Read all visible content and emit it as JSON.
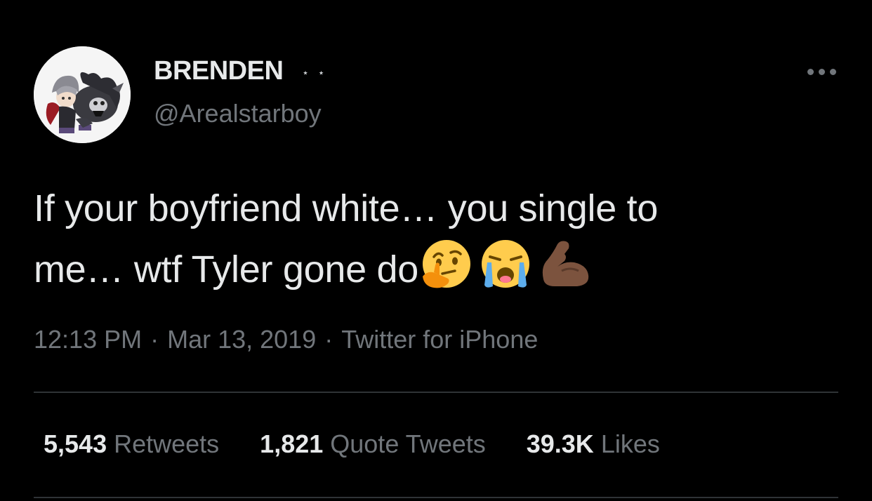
{
  "author": {
    "display_name": "BRENDEN",
    "name_decoration": "⋆ ⋆",
    "handle": "@Arealstarboy",
    "avatar_icon": "anime-character-avatar"
  },
  "tweet": {
    "line1": "If your boyfriend white… you single to",
    "line2": "me… wtf Tyler gone do",
    "emojis": [
      "thinking-face-emoji",
      "loudly-crying-face-emoji",
      "flexed-biceps-emoji"
    ]
  },
  "meta": {
    "time": "12:13 PM",
    "separator": "·",
    "date": "Mar 13, 2019",
    "source": "Twitter for iPhone"
  },
  "stats": {
    "retweets": {
      "count": "5,543",
      "label": "Retweets"
    },
    "quotes": {
      "count": "1,821",
      "label": "Quote Tweets"
    },
    "likes": {
      "count": "39.3K",
      "label": "Likes"
    }
  },
  "colors": {
    "background": "#000000",
    "primary_text": "#e7e9ea",
    "secondary_text": "#71767b",
    "divider": "#2f3336"
  }
}
